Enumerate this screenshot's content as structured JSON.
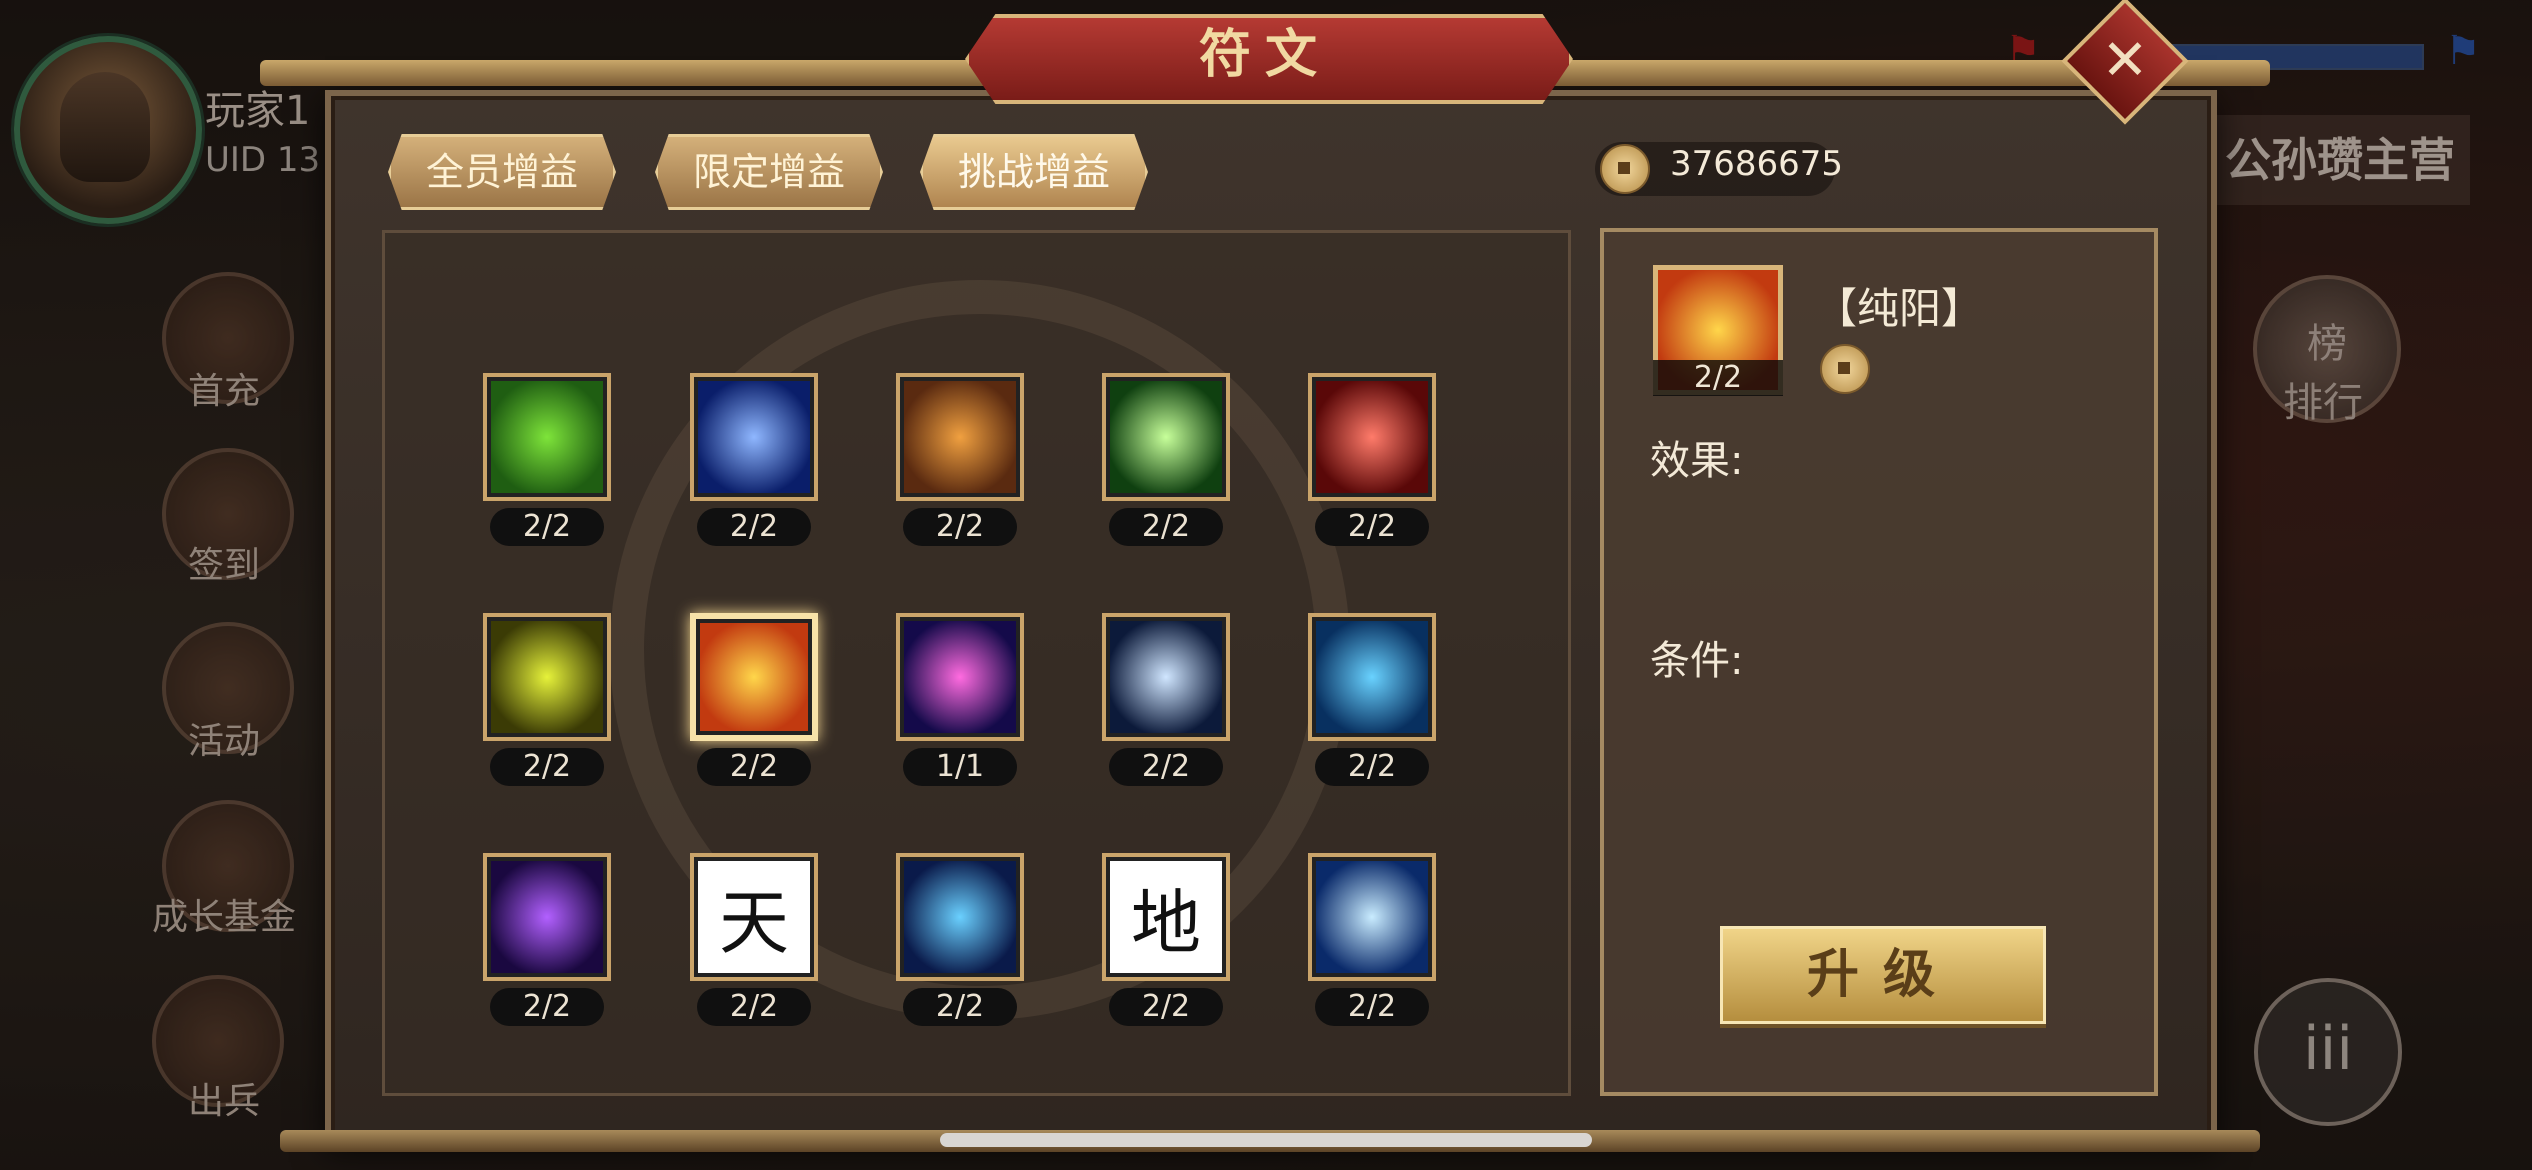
{
  "hud": {
    "player_name": "玩家1",
    "player_uid": "UID 13",
    "camp_title": "公孙瓒主营",
    "side_buttons": [
      "首充",
      "签到",
      "活动",
      "成长基金",
      "出兵"
    ],
    "rank_label": "排行",
    "rank_badge": "榜",
    "menu_glyph": "iii"
  },
  "dialog": {
    "title": "符文",
    "close_glyph": "✕",
    "tabs": [
      {
        "label": "全员增益",
        "active": false
      },
      {
        "label": "限定增益",
        "active": false
      },
      {
        "label": "挑战增益",
        "active": true
      }
    ],
    "coins": "37686675"
  },
  "runes": [
    {
      "icon": "green-dragon-icon",
      "count": "2/2",
      "colors": [
        "#1f5e12",
        "#7ee43a"
      ]
    },
    {
      "icon": "crescent-moon-icon",
      "count": "2/2",
      "colors": [
        "#0a1e6a",
        "#8fb7ff"
      ]
    },
    {
      "icon": "golden-warrior-icon",
      "count": "2/2",
      "colors": [
        "#5a2a10",
        "#f0a040"
      ]
    },
    {
      "icon": "green-burst-icon",
      "count": "2/2",
      "colors": [
        "#0f4010",
        "#c7ff9a"
      ]
    },
    {
      "icon": "red-phoenix-icon",
      "count": "2/2",
      "colors": [
        "#5a0808",
        "#ff7b6a"
      ]
    },
    {
      "icon": "yellow-titan-icon",
      "count": "2/2",
      "colors": [
        "#3b3b05",
        "#e6f23a"
      ]
    },
    {
      "icon": "yin-yang-icon",
      "count": "2/2",
      "colors": [
        "#c23a10",
        "#ffd64a"
      ],
      "selected": true
    },
    {
      "icon": "star-orbs-icon",
      "count": "1/1",
      "colors": [
        "#140a4a",
        "#ff6be0"
      ]
    },
    {
      "icon": "spirit-swirl-icon",
      "count": "2/2",
      "colors": [
        "#0c1a3a",
        "#d0e6ff"
      ]
    },
    {
      "icon": "blue-aura-icon",
      "count": "2/2",
      "colors": [
        "#083060",
        "#69d2ff"
      ]
    },
    {
      "icon": "purple-lightning-icon",
      "count": "2/2",
      "colors": [
        "#1a0840",
        "#b260ff"
      ]
    },
    {
      "icon": "heaven-glyph-icon",
      "count": "2/2",
      "glyph": "天"
    },
    {
      "icon": "vortex-icon",
      "count": "2/2",
      "colors": [
        "#0a1a4a",
        "#6ad0ff"
      ]
    },
    {
      "icon": "earth-glyph-icon",
      "count": "2/2",
      "glyph": "地"
    },
    {
      "icon": "ice-shatter-icon",
      "count": "2/2",
      "colors": [
        "#0a2a6a",
        "#c9ecff"
      ]
    }
  ],
  "detail": {
    "name": "【纯阳】",
    "count": "2/2",
    "effect_label": "效果:",
    "condition_label": "条件:",
    "upgrade_label": "升级"
  }
}
